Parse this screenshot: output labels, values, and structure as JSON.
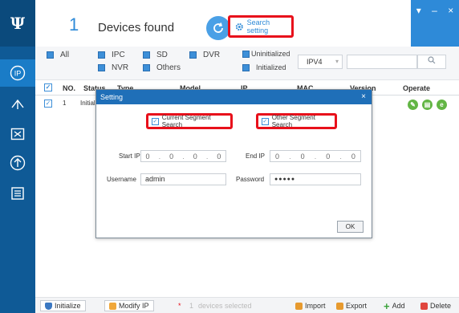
{
  "app": {
    "logo": "Ψ",
    "window_controls": [
      "▾",
      "–",
      "×"
    ]
  },
  "sidebar": {
    "items": [
      {
        "name": "ip-tool-icon",
        "active": true
      },
      {
        "name": "upgrade-icon",
        "active": false
      },
      {
        "name": "config-icon",
        "active": false
      },
      {
        "name": "upload-icon",
        "active": false
      },
      {
        "name": "list-icon",
        "active": false
      }
    ]
  },
  "header": {
    "count": "1",
    "found_label": "Devices found",
    "search_setting_label": "Search setting",
    "highlight_color": "#e8101b",
    "accent_color": "#2e8ad8"
  },
  "filters": {
    "all": "All",
    "ipc": "IPC",
    "sd": "SD",
    "dvr": "DVR",
    "nvr": "NVR",
    "others": "Others",
    "uninitialized": "Uninitialized",
    "initialized": "Initialized",
    "ip_version": "IPV4"
  },
  "table": {
    "headers": {
      "no": "NO.",
      "status": "Status",
      "type": "Type",
      "model": "Model",
      "ip": "IP",
      "mac": "MAC",
      "version": "Version",
      "operate": "Operate"
    },
    "rows": [
      {
        "no": "1",
        "status": "Initial"
      }
    ]
  },
  "dialog": {
    "title": "Setting",
    "close": "×",
    "current_segment": "Current Segment Search",
    "other_segment": "Other Segment Search",
    "start_ip_label": "Start IP",
    "end_ip_label": "End IP",
    "start_ip": [
      "0",
      "0",
      "0",
      "0"
    ],
    "end_ip": [
      "0",
      "0",
      "0",
      "0"
    ],
    "username_label": "Username",
    "username": "admin",
    "password_label": "Password",
    "password": "●●●●●",
    "ok": "OK"
  },
  "footer": {
    "initialize": "Initialize",
    "modify_ip": "Modify IP",
    "star": "*",
    "selected_count": "1",
    "selected_label": "devices selected",
    "import": "Import",
    "export": "Export",
    "add": "Add",
    "delete": "Delete"
  }
}
